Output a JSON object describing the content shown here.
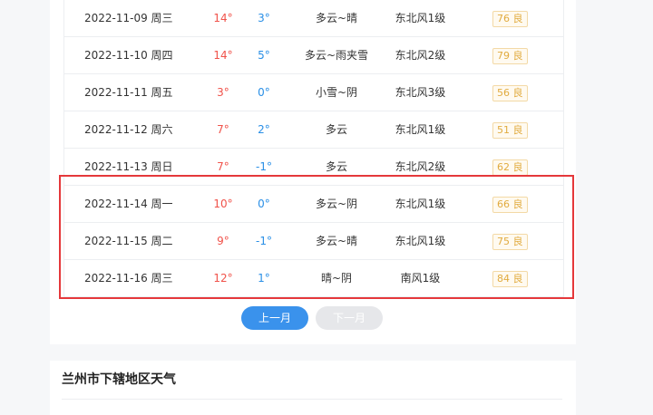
{
  "weather_table": {
    "rows": [
      {
        "date": "2022-11-09 周三",
        "high": "14°",
        "low": "3°",
        "weather": "多云~晴",
        "wind": "东北风1级",
        "aqi": "76 良"
      },
      {
        "date": "2022-11-10 周四",
        "high": "14°",
        "low": "5°",
        "weather": "多云~雨夹雪",
        "wind": "东北风2级",
        "aqi": "79 良"
      },
      {
        "date": "2022-11-11 周五",
        "high": "3°",
        "low": "0°",
        "weather": "小雪~阴",
        "wind": "东北风3级",
        "aqi": "56 良"
      },
      {
        "date": "2022-11-12 周六",
        "high": "7°",
        "low": "2°",
        "weather": "多云",
        "wind": "东北风1级",
        "aqi": "51 良"
      },
      {
        "date": "2022-11-13 周日",
        "high": "7°",
        "low": "-1°",
        "weather": "多云",
        "wind": "东北风2级",
        "aqi": "62 良"
      },
      {
        "date": "2022-11-14 周一",
        "high": "10°",
        "low": "0°",
        "weather": "多云~阴",
        "wind": "东北风1级",
        "aqi": "66 良"
      },
      {
        "date": "2022-11-15 周二",
        "high": "9°",
        "low": "-1°",
        "weather": "多云~晴",
        "wind": "东北风1级",
        "aqi": "75 良"
      },
      {
        "date": "2022-11-16 周三",
        "high": "12°",
        "low": "1°",
        "weather": "晴~阴",
        "wind": "南风1级",
        "aqi": "84 良"
      }
    ]
  },
  "pagination": {
    "prev_label": "上一月",
    "next_label": "下一月"
  },
  "section": {
    "title": "兰州市下辖地区天气"
  },
  "colors": {
    "high_temp": "#f0524a",
    "low_temp": "#2a8fe6",
    "highlight_border": "#e5383b",
    "primary_button": "#3a92ec",
    "aqi_text": "#e1ab3f"
  }
}
